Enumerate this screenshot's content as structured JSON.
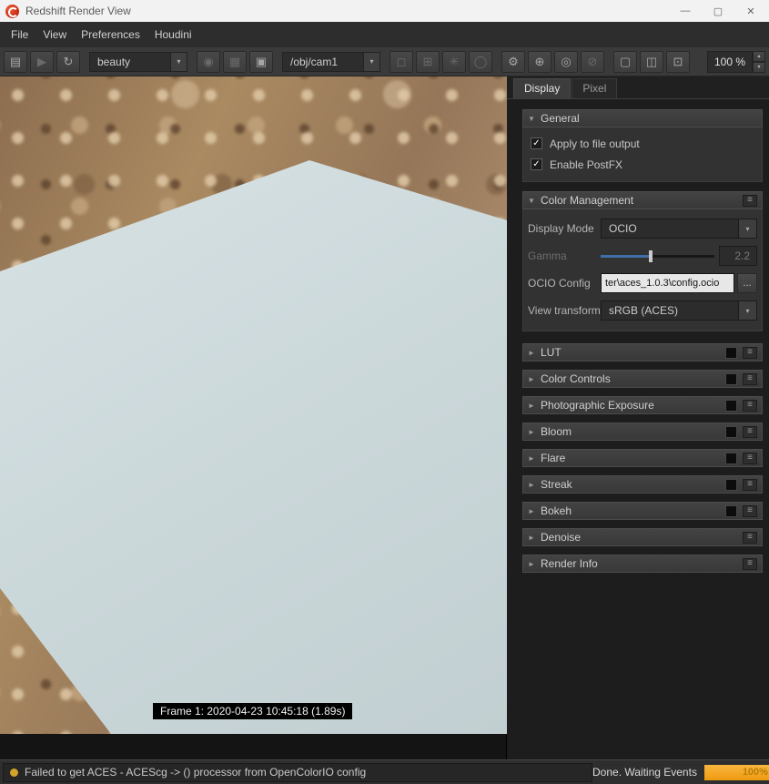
{
  "window": {
    "title": "Redshift Render View",
    "controls": {
      "minimize": "—",
      "maximize": "▢",
      "close": "✕"
    }
  },
  "menu": {
    "items": [
      {
        "label": "File"
      },
      {
        "label": "View"
      },
      {
        "label": "Preferences"
      },
      {
        "label": "Houdini"
      }
    ]
  },
  "icons": {
    "film": "▤",
    "play": "▶",
    "refresh": "↻",
    "rgba": "◉",
    "checker": "▦",
    "crop": "▣",
    "single": "◻",
    "tiles": "⊞",
    "star": "✳",
    "circle": "◯",
    "gear": "⚙",
    "target": "⊕",
    "pick": "◎",
    "slash": "⊘",
    "layers": "▢",
    "panels": "◫",
    "copy": "⊡",
    "dropdown": "▾",
    "spin_up": "▴",
    "spin_down": "▾",
    "tri_open": "▼",
    "tri_closed": "►",
    "menu": "≡",
    "check": "✓"
  },
  "toolbar": {
    "aov_value": "beauty",
    "camera_value": "/obj/cam1",
    "zoom_value": "100 %"
  },
  "viewport": {
    "frame_label": "Frame 1:  2020-04-23  10:45:18  (1.89s)"
  },
  "panel": {
    "tabs": [
      {
        "label": "Display"
      },
      {
        "label": "Pixel"
      }
    ],
    "general": {
      "label": "General",
      "options": [
        {
          "label": "Apply to file output",
          "checked": true
        },
        {
          "label": "Enable PostFX",
          "checked": true
        }
      ]
    },
    "color_management": {
      "label": "Color Management",
      "display_mode_label": "Display Mode",
      "display_mode_value": "OCIO",
      "gamma_label": "Gamma",
      "gamma_value": "2.2",
      "ocio_config_label": "OCIO Config",
      "ocio_config_value": "ter\\aces_1.0.3\\config.ocio",
      "browse_label": "...",
      "view_transform_label": "View transform",
      "view_transform_value": "sRGB (ACES)"
    },
    "sections": [
      {
        "label": "LUT"
      },
      {
        "label": "Color Controls"
      },
      {
        "label": "Photographic Exposure"
      },
      {
        "label": "Bloom"
      },
      {
        "label": "Flare"
      },
      {
        "label": "Streak"
      },
      {
        "label": "Bokeh"
      },
      {
        "label": "Denoise"
      },
      {
        "label": "Render Info"
      }
    ]
  },
  "statusbar": {
    "message": "Failed to get ACES - ACEScg ->  () processor from OpenColorIO config",
    "status": "Done. Waiting Events",
    "progress_label": "100%"
  },
  "colors": {
    "progress": "#f0a11c",
    "slider_fill": "#3f6ea8",
    "shape": "#cbd8da",
    "status_dot": "#d2a52a"
  }
}
